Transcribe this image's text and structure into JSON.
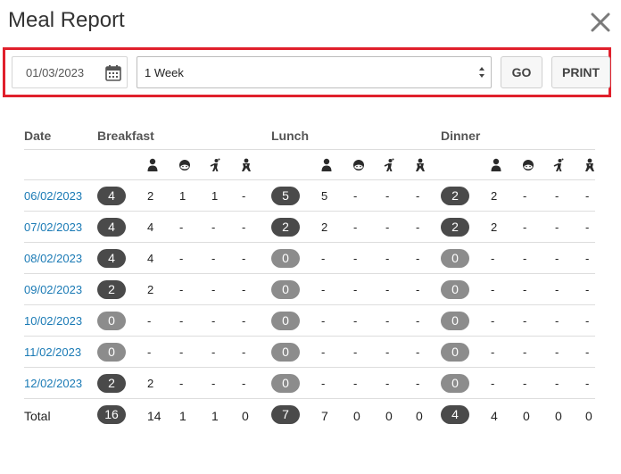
{
  "modal": {
    "title": "Meal Report"
  },
  "controls": {
    "date_value": "01/03/2023",
    "period_value": "1 Week",
    "go_label": "GO",
    "print_label": "PRINT",
    "highlight_color": "#e0202c"
  },
  "table": {
    "headers": {
      "date": "Date",
      "breakfast": "Breakfast",
      "lunch": "Lunch",
      "dinner": "Dinner"
    },
    "subcolumn_icons": [
      "adult-icon",
      "child-icon",
      "toddler-icon",
      "baby-icon"
    ],
    "rows": [
      {
        "date": "06/02/2023",
        "breakfast": {
          "total": "4",
          "counts": [
            "2",
            "1",
            "1",
            "-"
          ]
        },
        "lunch": {
          "total": "5",
          "counts": [
            "5",
            "-",
            "-",
            "-"
          ]
        },
        "dinner": {
          "total": "2",
          "counts": [
            "2",
            "-",
            "-",
            "-"
          ]
        }
      },
      {
        "date": "07/02/2023",
        "breakfast": {
          "total": "4",
          "counts": [
            "4",
            "-",
            "-",
            "-"
          ]
        },
        "lunch": {
          "total": "2",
          "counts": [
            "2",
            "-",
            "-",
            "-"
          ]
        },
        "dinner": {
          "total": "2",
          "counts": [
            "2",
            "-",
            "-",
            "-"
          ]
        }
      },
      {
        "date": "08/02/2023",
        "breakfast": {
          "total": "4",
          "counts": [
            "4",
            "-",
            "-",
            "-"
          ]
        },
        "lunch": {
          "total": "0",
          "counts": [
            "-",
            "-",
            "-",
            "-"
          ]
        },
        "dinner": {
          "total": "0",
          "counts": [
            "-",
            "-",
            "-",
            "-"
          ]
        }
      },
      {
        "date": "09/02/2023",
        "breakfast": {
          "total": "2",
          "counts": [
            "2",
            "-",
            "-",
            "-"
          ]
        },
        "lunch": {
          "total": "0",
          "counts": [
            "-",
            "-",
            "-",
            "-"
          ]
        },
        "dinner": {
          "total": "0",
          "counts": [
            "-",
            "-",
            "-",
            "-"
          ]
        }
      },
      {
        "date": "10/02/2023",
        "breakfast": {
          "total": "0",
          "counts": [
            "-",
            "-",
            "-",
            "-"
          ]
        },
        "lunch": {
          "total": "0",
          "counts": [
            "-",
            "-",
            "-",
            "-"
          ]
        },
        "dinner": {
          "total": "0",
          "counts": [
            "-",
            "-",
            "-",
            "-"
          ]
        }
      },
      {
        "date": "11/02/2023",
        "breakfast": {
          "total": "0",
          "counts": [
            "-",
            "-",
            "-",
            "-"
          ]
        },
        "lunch": {
          "total": "0",
          "counts": [
            "-",
            "-",
            "-",
            "-"
          ]
        },
        "dinner": {
          "total": "0",
          "counts": [
            "-",
            "-",
            "-",
            "-"
          ]
        }
      },
      {
        "date": "12/02/2023",
        "breakfast": {
          "total": "2",
          "counts": [
            "2",
            "-",
            "-",
            "-"
          ]
        },
        "lunch": {
          "total": "0",
          "counts": [
            "-",
            "-",
            "-",
            "-"
          ]
        },
        "dinner": {
          "total": "0",
          "counts": [
            "-",
            "-",
            "-",
            "-"
          ]
        }
      }
    ],
    "total": {
      "label": "Total",
      "breakfast": {
        "total": "16",
        "counts": [
          "14",
          "1",
          "1",
          "0"
        ]
      },
      "lunch": {
        "total": "7",
        "counts": [
          "7",
          "0",
          "0",
          "0"
        ]
      },
      "dinner": {
        "total": "4",
        "counts": [
          "4",
          "0",
          "0",
          "0"
        ]
      }
    }
  }
}
